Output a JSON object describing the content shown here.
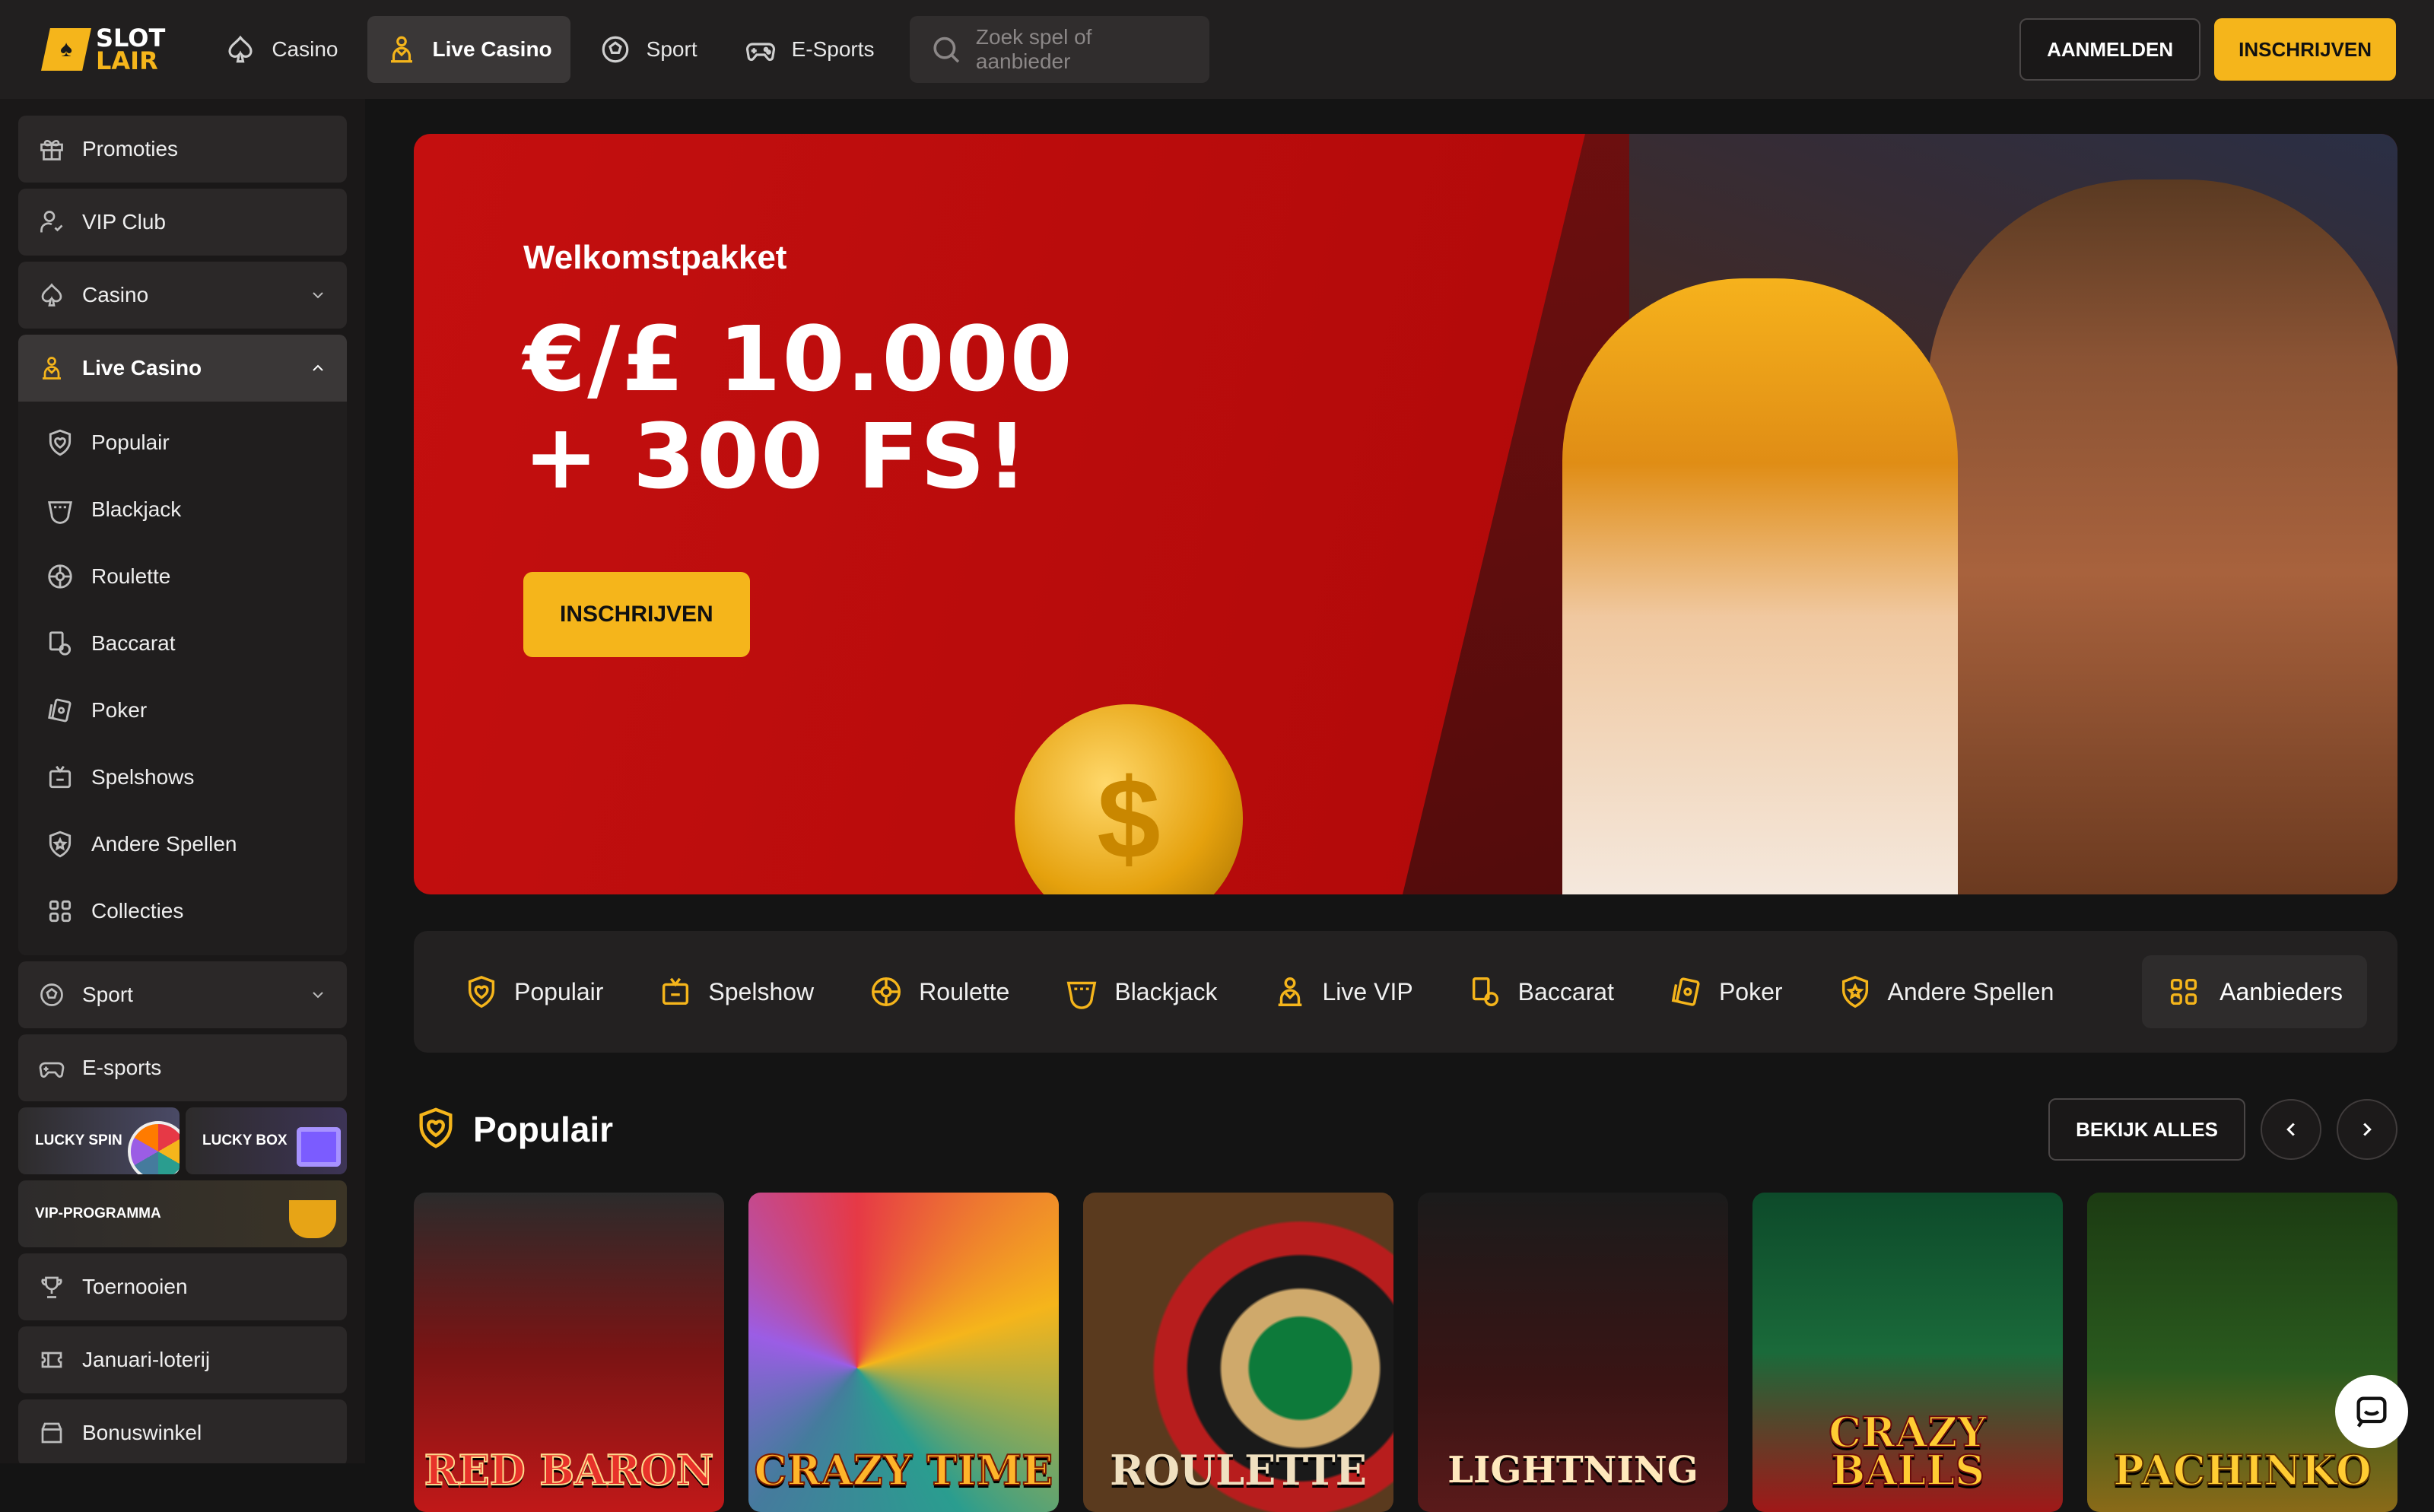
{
  "header": {
    "logo": {
      "line1": "SLOT",
      "line2": "LAIR"
    },
    "nav": [
      {
        "label": "Casino",
        "icon": "spade-icon",
        "active": false
      },
      {
        "label": "Live Casino",
        "icon": "dealer-icon",
        "active": true
      },
      {
        "label": "Sport",
        "icon": "soccer-ball-icon",
        "active": false
      },
      {
        "label": "E-Sports",
        "icon": "gamepad-icon",
        "active": false
      }
    ],
    "search_placeholder": "Zoek spel of aanbieder",
    "login_label": "AANMELDEN",
    "signup_label": "INSCHRIJVEN"
  },
  "sidebar": {
    "items_top": [
      {
        "label": "Promoties",
        "icon": "gift-icon"
      },
      {
        "label": "VIP Club",
        "icon": "vip-user-icon"
      },
      {
        "label": "Casino",
        "icon": "spade-icon",
        "expandable": true
      }
    ],
    "live_casino": {
      "label": "Live Casino",
      "icon": "dealer-icon",
      "subitems": [
        {
          "label": "Populair",
          "icon": "heart-shield-icon"
        },
        {
          "label": "Blackjack",
          "icon": "cards-icon"
        },
        {
          "label": "Roulette",
          "icon": "roulette-icon"
        },
        {
          "label": "Baccarat",
          "icon": "baccarat-icon"
        },
        {
          "label": "Poker",
          "icon": "poker-icon"
        },
        {
          "label": "Spelshows",
          "icon": "tv-icon"
        },
        {
          "label": "Andere Spellen",
          "icon": "star-shield-icon"
        },
        {
          "label": "Collecties",
          "icon": "grid-icon"
        }
      ]
    },
    "items_bottom": [
      {
        "label": "Sport",
        "icon": "soccer-ball-icon",
        "expandable": true
      },
      {
        "label": "E-sports",
        "icon": "gamepad-icon"
      }
    ],
    "promo_tiles": {
      "lucky_spin": "LUCKY SPIN",
      "lucky_box": "LUCKY BOX",
      "vip_program": "VIP-PROGRAMMA"
    },
    "items_extra": [
      {
        "label": "Toernooien",
        "icon": "trophy-icon"
      },
      {
        "label": "Januari-loterij",
        "icon": "ticket-icon"
      },
      {
        "label": "Bonuswinkel",
        "icon": "shop-icon"
      }
    ]
  },
  "hero": {
    "eyebrow": "Welkomstpakket",
    "title_line1": "€/£ 10.000",
    "title_line2": "+ 300 FS!",
    "cta": "INSCHRIJVEN"
  },
  "categories": [
    {
      "label": "Populair",
      "icon": "heart-shield-icon"
    },
    {
      "label": "Spelshow",
      "icon": "tv-icon"
    },
    {
      "label": "Roulette",
      "icon": "roulette-icon"
    },
    {
      "label": "Blackjack",
      "icon": "cards-icon"
    },
    {
      "label": "Live VIP",
      "icon": "dealer-icon"
    },
    {
      "label": "Baccarat",
      "icon": "baccarat-icon"
    },
    {
      "label": "Poker",
      "icon": "poker-icon"
    },
    {
      "label": "Andere Spellen",
      "icon": "star-shield-icon"
    }
  ],
  "providers_label": "Aanbieders",
  "section": {
    "title": "Populair",
    "view_all": "BEKIJK ALLES"
  },
  "games": [
    {
      "name": "RED BARON"
    },
    {
      "name": "CRAZY TIME"
    },
    {
      "name": "ROULETTE"
    },
    {
      "name": "LIGHTNING"
    },
    {
      "name": "CRAZY BALLS"
    },
    {
      "name": "PACHINKO"
    }
  ],
  "colors": {
    "accent": "#f5b51b",
    "hero_red": "#c40f0f",
    "bg": "#141414",
    "panel": "#232121"
  }
}
